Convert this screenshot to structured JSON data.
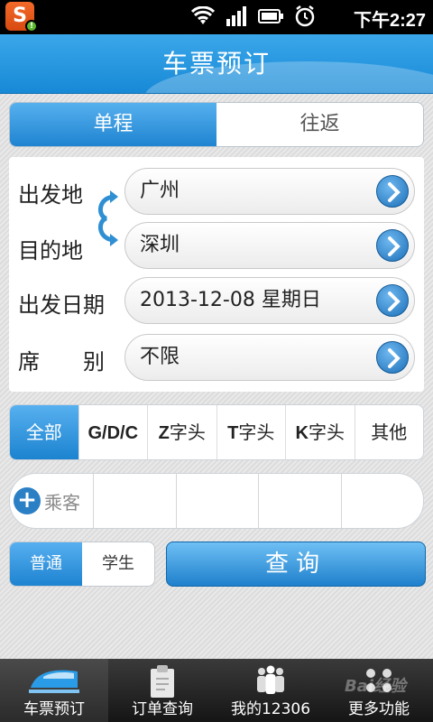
{
  "status_bar": {
    "app_badge": "S",
    "time": "下午2:27"
  },
  "header": {
    "title": "车票预订"
  },
  "trip_type": {
    "options": [
      "单程",
      "往返"
    ],
    "selected": "单程"
  },
  "form": {
    "origin_label": "出发地",
    "origin_value": "广州",
    "destination_label": "目的地",
    "destination_value": "深圳",
    "date_label": "出发日期",
    "date_value": "2013-12-08 星期日",
    "seat_label": "席　　别",
    "seat_value": "不限"
  },
  "train_filter": {
    "all": "全部",
    "gdc": "G/D/C",
    "z_prefix": "Z",
    "t_prefix": "T",
    "k_prefix": "K",
    "prefix_suffix": "字头",
    "other": "其他"
  },
  "passengers": {
    "add_label": "乘客"
  },
  "passenger_type": {
    "options": [
      "普通",
      "学生"
    ],
    "selected": "普通"
  },
  "search_button": "查询",
  "tabbar": {
    "tabs": [
      "车票预订",
      "订单查询",
      "我的12306",
      "更多功能"
    ],
    "active": "车票预订"
  },
  "watermark": "Bai经验",
  "colors": {
    "accent": "#1f84d1",
    "header": "#2a98e0",
    "tabbar": "#1e1e1e"
  }
}
